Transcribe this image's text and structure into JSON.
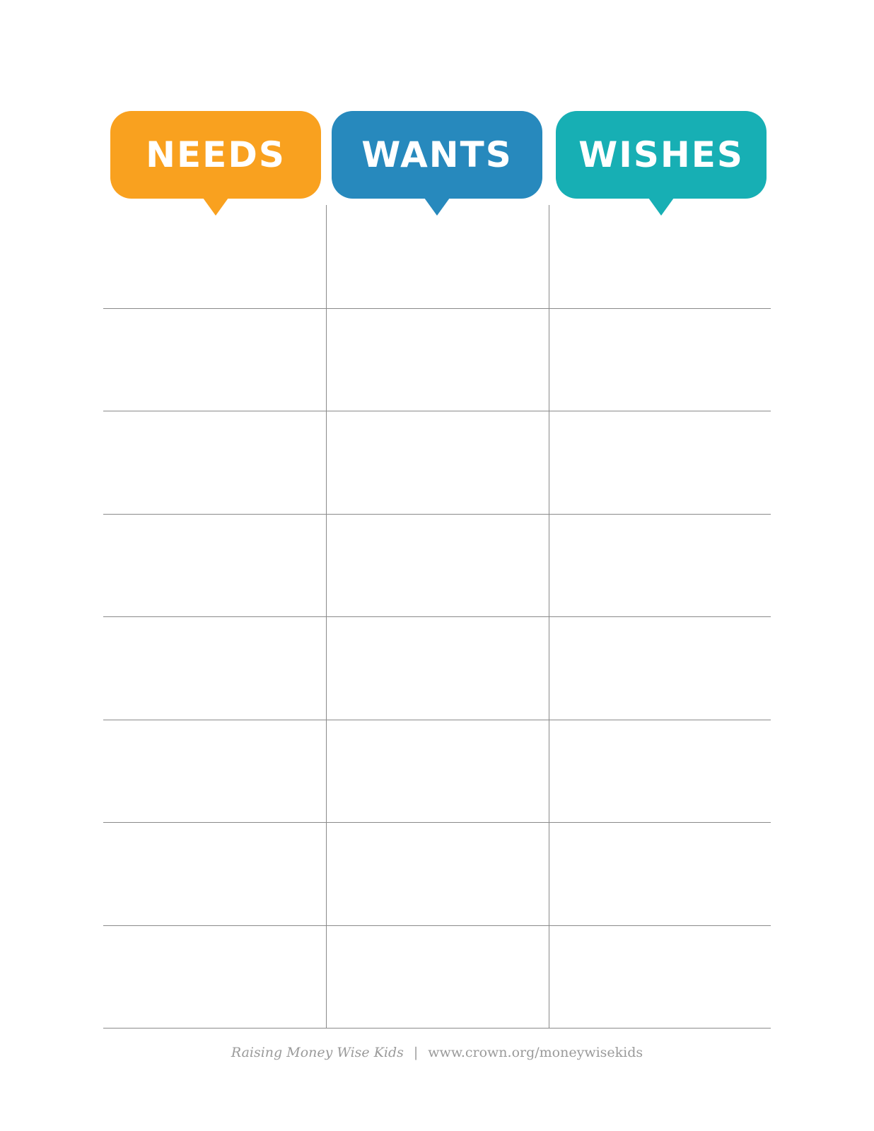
{
  "columns": [
    {
      "key": "needs",
      "label": "NEEDS",
      "color": "#f9a11f"
    },
    {
      "key": "wants",
      "label": "WANTS",
      "color": "#2789bd"
    },
    {
      "key": "wishes",
      "label": "WISHES",
      "color": "#17afb4"
    }
  ],
  "table": {
    "row_count": 8,
    "rows": [
      [
        "",
        "",
        ""
      ],
      [
        "",
        "",
        ""
      ],
      [
        "",
        "",
        ""
      ],
      [
        "",
        "",
        ""
      ],
      [
        "",
        "",
        ""
      ],
      [
        "",
        "",
        ""
      ],
      [
        "",
        "",
        ""
      ],
      [
        "",
        "",
        ""
      ]
    ],
    "line_color": "#8a8a8a"
  },
  "footer": {
    "brand": "Raising Money Wise Kids",
    "separator": "|",
    "url": "www.crown.org/moneywisekids"
  }
}
